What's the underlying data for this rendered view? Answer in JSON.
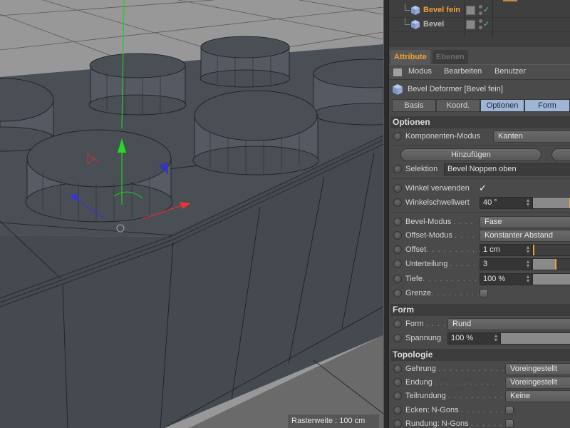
{
  "viewport": {
    "grid_readout": "Rasterweite : 100 cm",
    "axis_colors": {
      "x": "#e83030",
      "y": "#22cc22",
      "z": "#3030e0"
    }
  },
  "object_manager": {
    "items": [
      {
        "name": "Bevel fein",
        "active": true,
        "enabled_check": "✓"
      },
      {
        "name": "Bevel",
        "active": false,
        "enabled_check": "✓"
      }
    ]
  },
  "tabs": {
    "active": "Attribute",
    "inactive": "Ebenen"
  },
  "menu": {
    "items": [
      "Modus",
      "Bearbeiten",
      "Benutzer"
    ]
  },
  "object_header": {
    "title": "Bevel Deformer [Bevel fein]"
  },
  "subtabs": [
    {
      "label": "Basis",
      "active": false
    },
    {
      "label": "Koord.",
      "active": false
    },
    {
      "label": "Optionen",
      "active": true
    },
    {
      "label": "Form",
      "active": true
    }
  ],
  "optionen": {
    "title": "Optionen",
    "komponenten_modus": {
      "label": "Komponenten-Modus",
      "value": "Kanten"
    },
    "hinzufuegen_label": "Hinzufügen",
    "selektion": {
      "label": "Selektion",
      "value": "Bevel Noppen oben"
    },
    "winkel_verwenden": {
      "label": "Winkel verwenden",
      "checked": true,
      "check": "✓"
    },
    "winkelschwellwert": {
      "label": "Winkelschwellwert",
      "value": "40 °",
      "slider_fraction": 0.98
    },
    "bevel_modus": {
      "label": "Bevel-Modus",
      "dots": ". . . .",
      "value": "Fase"
    },
    "offset_modus": {
      "label": "Offset-Modus",
      "dots": ". . . .",
      "value": "Konstanter Abstand"
    },
    "offset": {
      "label": "Offset",
      "dots": ". . . . . . . . . . .",
      "value": "1 cm",
      "slider_fraction": 0.01
    },
    "unterteilung": {
      "label": "Unterteilung",
      "dots": ". . . . . .",
      "value": "3",
      "slider_fraction": 0.6
    },
    "tiefe": {
      "label": "Tiefe",
      "dots": ". . . . . . . . . . . .",
      "value": "100 %",
      "slider_fraction": 1.0
    },
    "grenze": {
      "label": "Grenze",
      "dots": ". . . . . . . . . .",
      "checked": false
    }
  },
  "form": {
    "title": "Form",
    "form": {
      "label": "Form",
      "dots": ". . . .",
      "value": "Rund"
    },
    "spannung": {
      "label": "Spannung",
      "value": "100 %",
      "slider_fraction": 1.0
    }
  },
  "topologie": {
    "title": "Topologie",
    "gehrung": {
      "label": "Gehrung",
      "dots": ". . . . . . . . . . . . . .",
      "value": "Voreingestellt"
    },
    "endung": {
      "label": "Endung",
      "dots": ". . . . . . . . . . . . . . .",
      "value": "Voreingestellt"
    },
    "teilrundung": {
      "label": "Teilrundung",
      "dots": ". . . . . . . . . . . .",
      "value": "Keine"
    },
    "ecken_ngons": {
      "label": "Ecken: N-Gons",
      "dots": ". . . . . . . . .",
      "checked": false
    },
    "rundung_ngons": {
      "label": "Rundung: N-Gons",
      "dots": ". . . . . . .",
      "checked": false
    }
  }
}
